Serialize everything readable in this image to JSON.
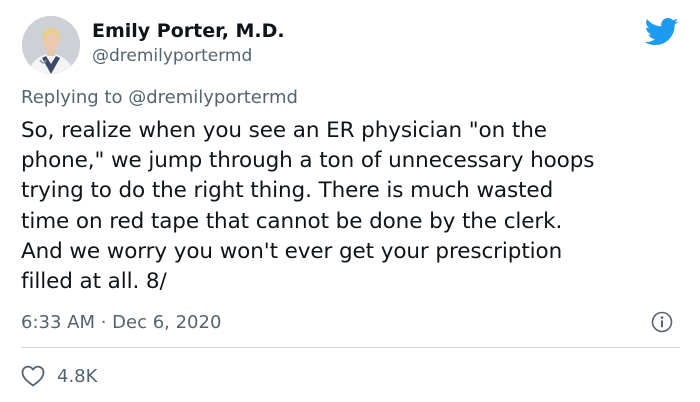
{
  "author": {
    "display_name": "Emily Porter, M.D.",
    "handle": "@dremilyportermd"
  },
  "reply": {
    "prefix": "Replying to",
    "target": "@dremilyportermd"
  },
  "tweet": {
    "lines": [
      "So, realize when you see an ER physician \"on the",
      "phone,\" we jump through a ton of unnecessary hoops",
      "trying to do the right thing. There is much wasted",
      "time on red tape that cannot be done by the clerk.",
      "And we worry you won't ever get your prescription",
      "filled at all. 8/"
    ],
    "timestamp": "6:33 AM · Dec 6, 2020"
  },
  "engagement": {
    "likes": "4.8K"
  },
  "icons": {
    "brand": "twitter-bird-icon",
    "info": "info-icon",
    "like": "heart-icon"
  },
  "colors": {
    "brand_blue": "#1d9bf0",
    "secondary_text": "#536471",
    "divider": "#cfd9de"
  }
}
